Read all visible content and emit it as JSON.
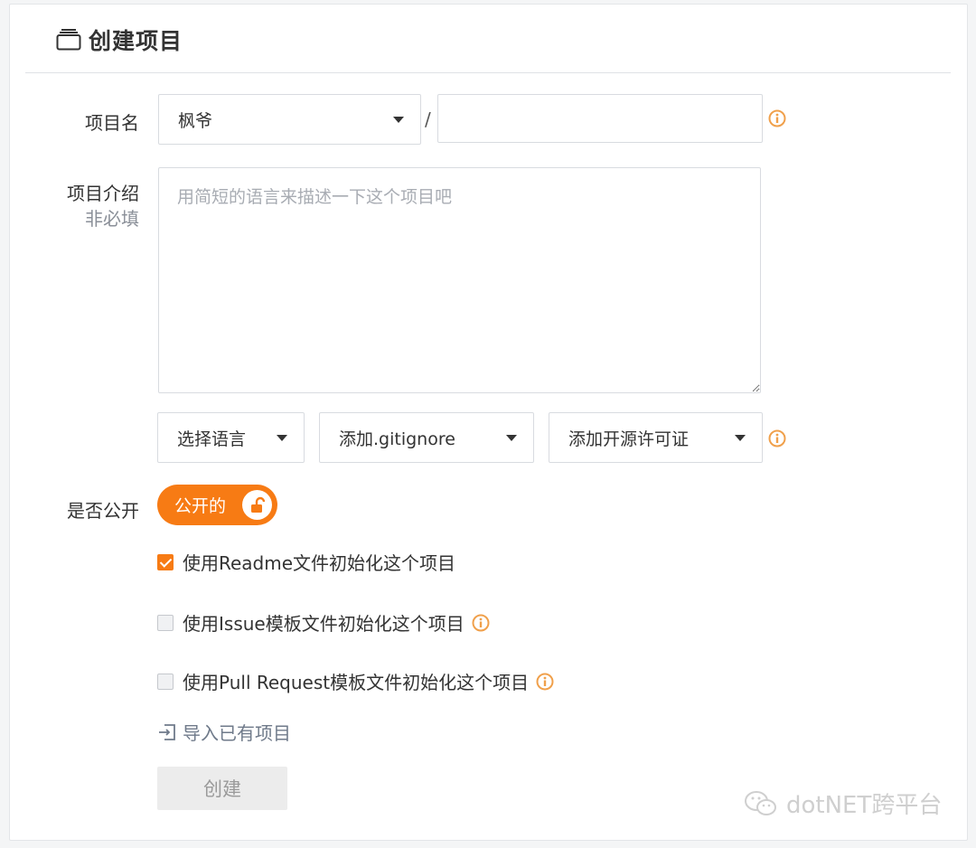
{
  "header": {
    "title": "创建项目",
    "icon": "folder-icon"
  },
  "form": {
    "name_label": "项目名",
    "owner_value": "枫爷",
    "slash": "/",
    "project_name_value": "",
    "description_label": "项目介绍",
    "description_sublabel": "非必填",
    "description_placeholder": "用简短的语言来描述一下这个项目吧",
    "language_select": "选择语言",
    "gitignore_select": "添加.gitignore",
    "license_select": "添加开源许可证",
    "public_label": "是否公开",
    "public_toggle": "公开的",
    "options": [
      {
        "label": "使用Readme文件初始化这个项目",
        "checked": true,
        "info": false
      },
      {
        "label": "使用Issue模板文件初始化这个项目",
        "checked": false,
        "info": true
      },
      {
        "label": "使用Pull Request模板文件初始化这个项目",
        "checked": false,
        "info": true
      }
    ],
    "import_link": "导入已有项目",
    "create_button": "创建"
  },
  "watermark": "dotNET跨平台",
  "colors": {
    "accent": "#f77b14",
    "info": "#f0a04b",
    "muted": "#6f7a8a"
  }
}
